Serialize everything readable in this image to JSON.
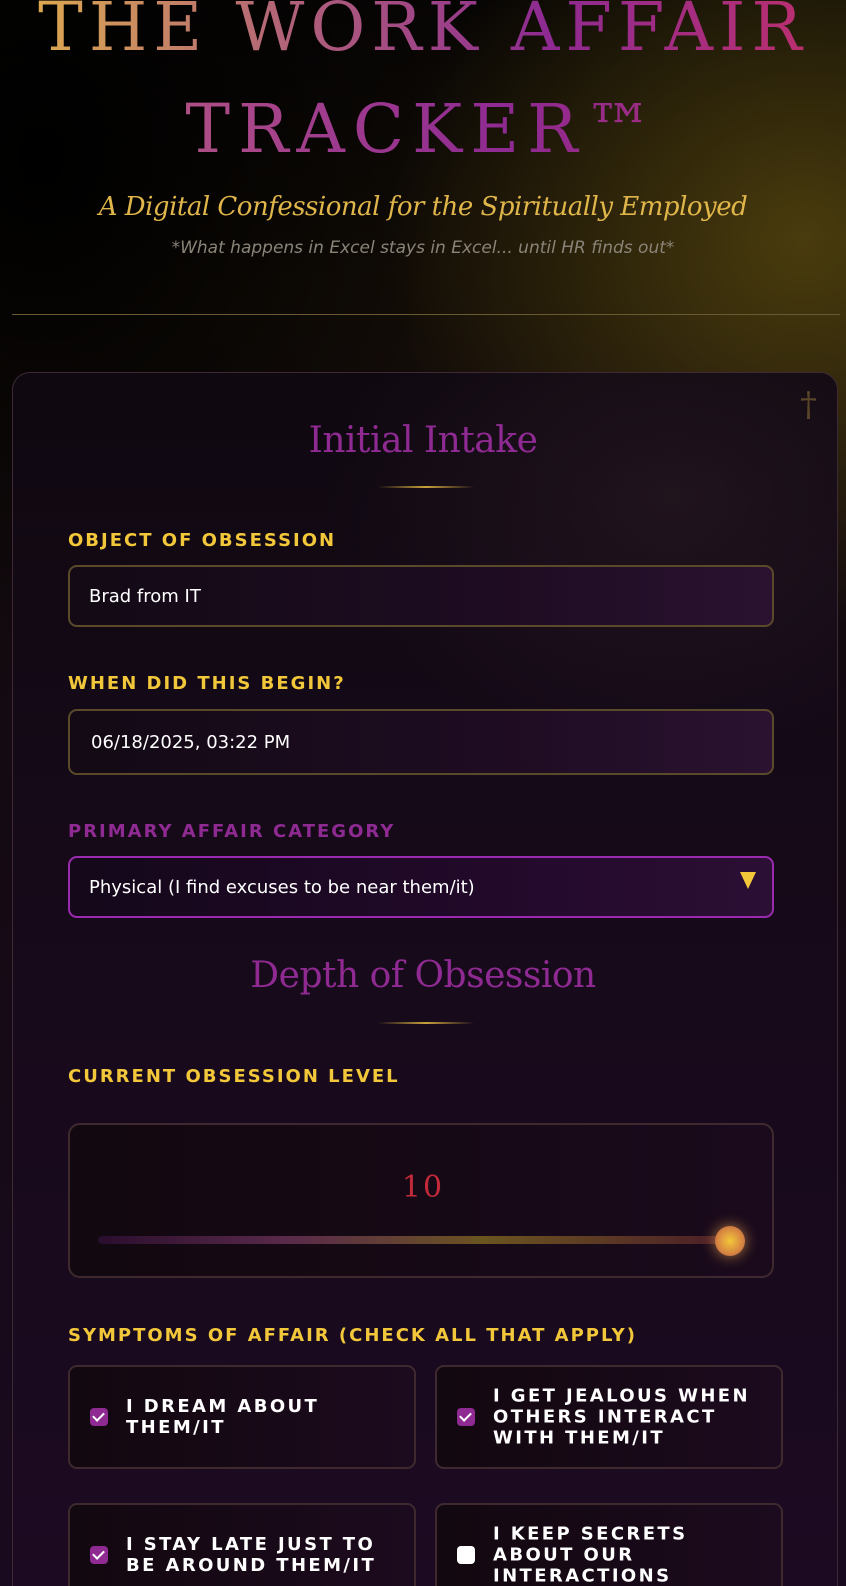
{
  "header": {
    "title_line1": "THE WORK AFFAIR",
    "title_line2": "TRACKER™",
    "subtitle": "A Digital Confessional for the Spiritually Employed",
    "tagline": "*What happens in Excel stays in Excel... until HR finds out*"
  },
  "panel": {
    "cross_icon": "†"
  },
  "intake": {
    "title": "Initial Intake",
    "object_label": "OBJECT OF OBSESSION",
    "object_value": "Brad from IT",
    "begin_label": "WHEN DID THIS BEGIN?",
    "begin_value": "06/18/2025, 03:22 PM",
    "category_label": "PRIMARY AFFAIR CATEGORY",
    "category_value": "Physical (I find excuses to be near them/it)"
  },
  "depth": {
    "title": "Depth of Obsession",
    "level_label": "CURRENT OBSESSION LEVEL",
    "level_value": "10",
    "level_fraction": 1.0
  },
  "symptoms": {
    "label": "SYMPTOMS OF AFFAIR (CHECK ALL THAT APPLY)",
    "items": [
      {
        "label": "I dream about them/it",
        "checked": true
      },
      {
        "label": "I get jealous when others interact with them/it",
        "checked": true
      },
      {
        "label": "I stay late just to be around them/it",
        "checked": true
      },
      {
        "label": "I keep secrets about our interactions",
        "checked": false
      }
    ]
  },
  "colors": {
    "gold": "#f2c73a",
    "purple": "#8e2a92",
    "crimson": "#c22a3a"
  }
}
